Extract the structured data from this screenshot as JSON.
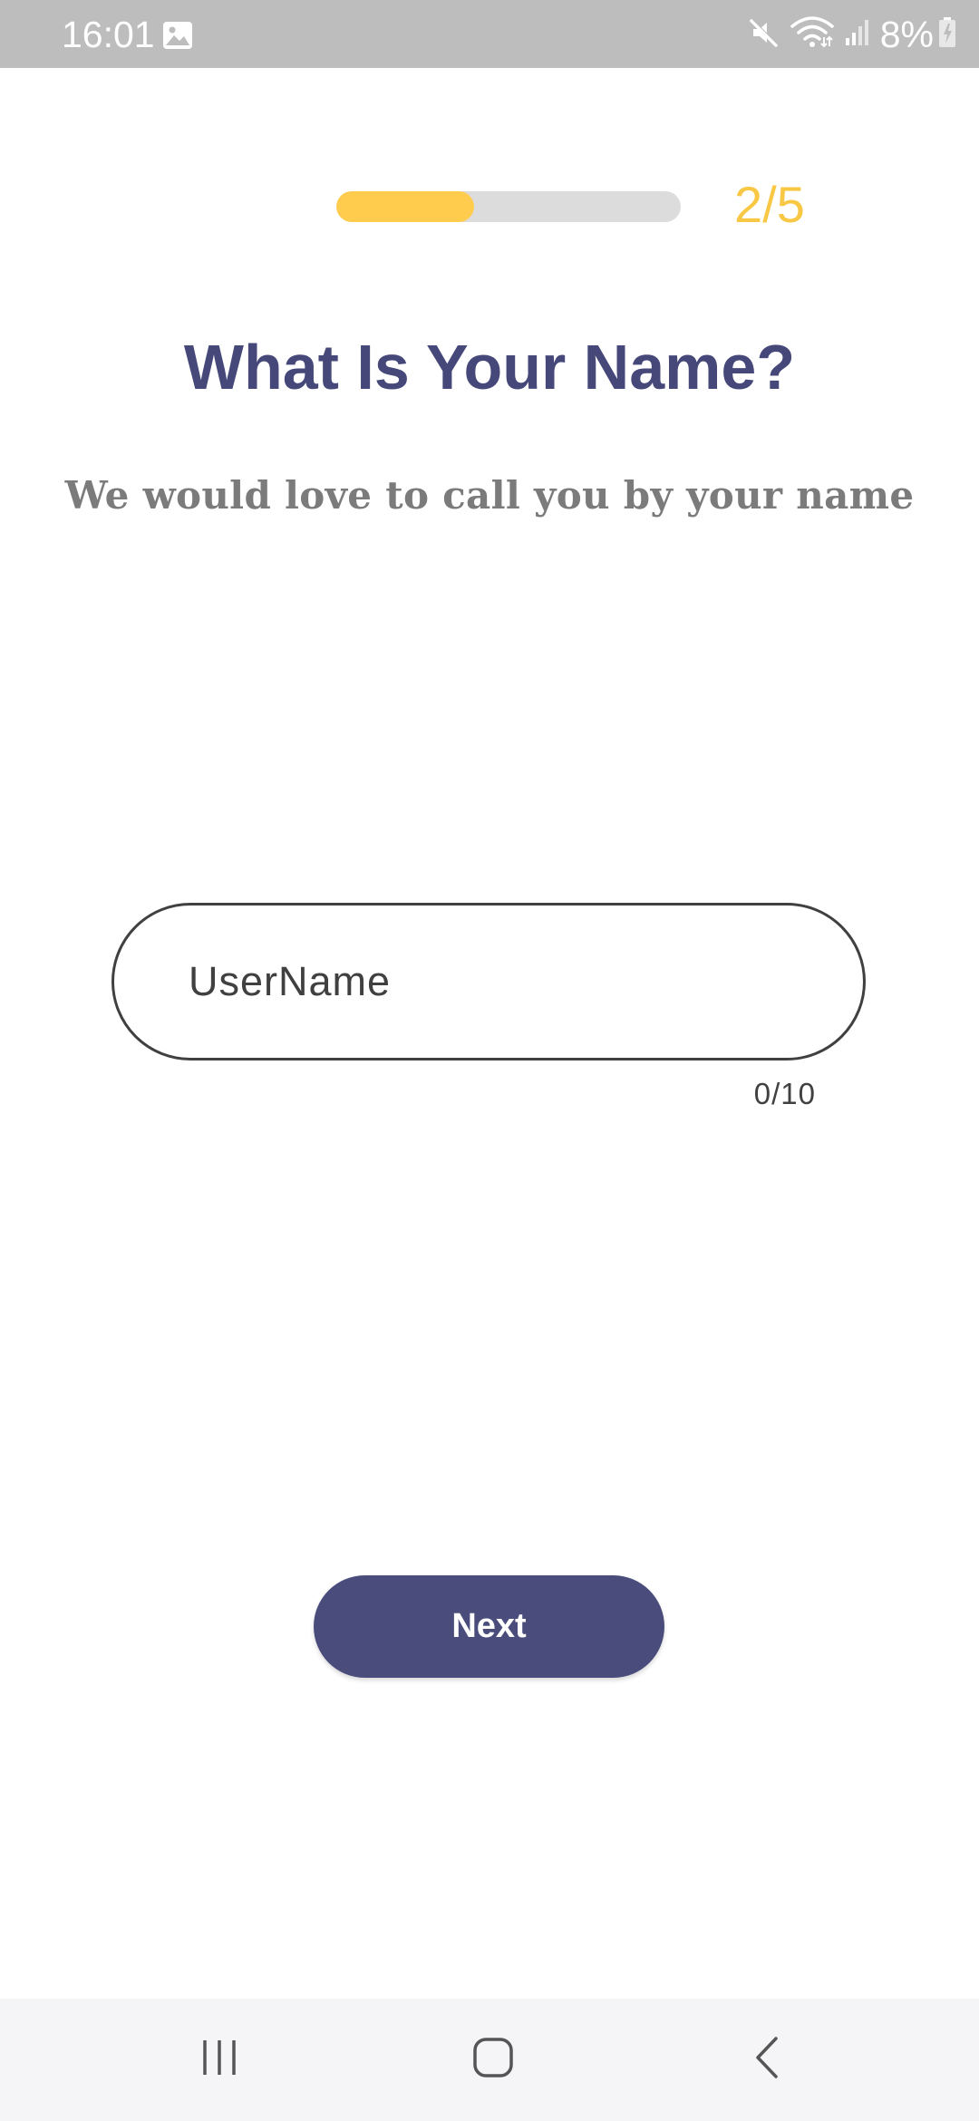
{
  "status_bar": {
    "time": "16:01",
    "battery": "8%",
    "icons": [
      "gallery-icon",
      "mute-icon",
      "wifi-icon",
      "signal-icon",
      "battery-charging-icon"
    ]
  },
  "progress": {
    "step_label": "2/5",
    "current_step": 2,
    "total_steps": 5,
    "fill_fraction": 0.4,
    "fill_color": "#ffcc4d",
    "track_color": "#dcdcdc"
  },
  "header": {
    "title": "What Is Your Name?",
    "subtitle": "We would love to call you by your name"
  },
  "name_field": {
    "value": "",
    "placeholder": "UserName",
    "counter": "0/10"
  },
  "actions": {
    "next_label": "Next"
  },
  "colors": {
    "accent": "#4a4d7b",
    "title": "#454878",
    "highlight": "#f8c845"
  },
  "nav_bar": {
    "buttons": [
      "recent-apps-icon",
      "home-icon",
      "back-icon"
    ]
  }
}
